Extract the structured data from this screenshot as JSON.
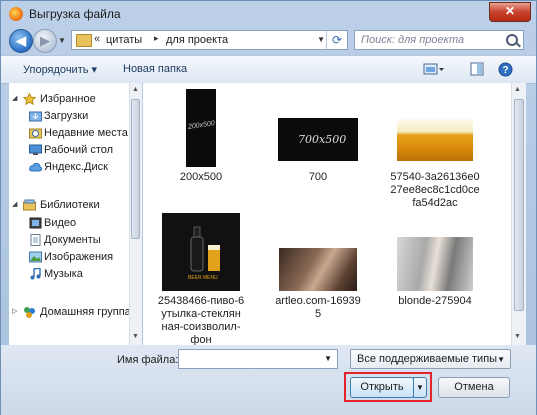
{
  "window": {
    "title": "Выгрузка файла",
    "close": "✕"
  },
  "address": {
    "sep1": "«",
    "crumbs": [
      "цитаты",
      "для проекта"
    ],
    "sep2": "▸"
  },
  "search": {
    "placeholder": "Поиск: для проекта"
  },
  "toolbar": {
    "organize": "Упорядочить ▾",
    "new_folder": "Новая папка"
  },
  "sidebar": {
    "items": [
      {
        "label": "Избранное",
        "icon": "star-icon"
      },
      {
        "label": "Загрузки",
        "icon": "download-folder-icon"
      },
      {
        "label": "Недавние места",
        "icon": "recent-places-icon"
      },
      {
        "label": "Рабочий стол",
        "icon": "desktop-icon"
      },
      {
        "label": "Яндекс.Диск",
        "icon": "cloud-icon"
      },
      {
        "label": "Библиотеки",
        "icon": "libraries-icon"
      },
      {
        "label": "Видео",
        "icon": "video-icon"
      },
      {
        "label": "Документы",
        "icon": "documents-icon"
      },
      {
        "label": "Изображения",
        "icon": "pictures-icon"
      },
      {
        "label": "Музыка",
        "icon": "music-icon"
      },
      {
        "label": "Домашняя группа",
        "icon": "homegroup-icon"
      }
    ]
  },
  "files": [
    {
      "name": "200x500",
      "caption": [
        "200x500"
      ],
      "thumb_text": "200x500"
    },
    {
      "name": "700",
      "caption": [
        "700"
      ],
      "thumb_text": "700x500"
    },
    {
      "name": "57540-3a26136e027ee8ec8c1cd0cefa54d2ac",
      "caption": [
        "57540-3a26136e0",
        "27ee8ec8c1cd0ce",
        "fa54d2ac"
      ]
    },
    {
      "name": "25438466-пиво-6утылка-стеклянная-соизволил-фон",
      "caption": [
        "25438466-пиво-6",
        "утылка-стеклян",
        "ная-соизволил-",
        "фон"
      ],
      "thumb_text": "BEER MENU"
    },
    {
      "name": "artleo.com-169395",
      "caption": [
        "artleo.com-16939",
        "5"
      ]
    },
    {
      "name": "blonde-275904",
      "caption": [
        "blonde-275904"
      ]
    }
  ],
  "bottom": {
    "filename_label": "Имя файла:",
    "filename_value": "",
    "filetype": "Все поддерживаемые типы",
    "open_label": "Открыть",
    "cancel_label": "Отмена"
  },
  "colors": {
    "highlight": "#e3242b",
    "accent": "#3c7fb1"
  }
}
